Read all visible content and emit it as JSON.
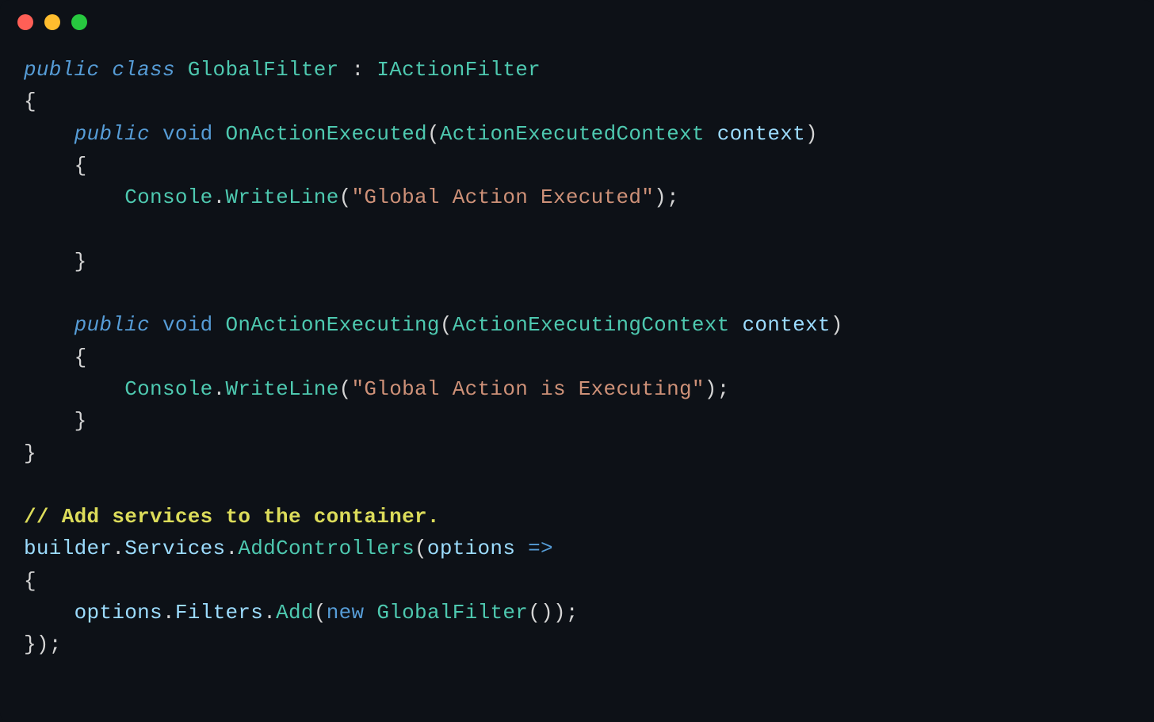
{
  "traffic_lights": {
    "red": "close",
    "yellow": "minimize",
    "green": "maximize"
  },
  "code": {
    "l1": {
      "kw_public": "public",
      "kw_class": "class",
      "name": "GlobalFilter",
      "colon": " : ",
      "iface": "IActionFilter"
    },
    "l2": {
      "brace": "{"
    },
    "l3": {
      "indent": "    ",
      "kw_public": "public",
      "kw_void": "void",
      "method": "OnActionExecuted",
      "lpar": "(",
      "ptype": "ActionExecutedContext",
      "pname": "context",
      "rpar": ")"
    },
    "l4": {
      "indent": "    ",
      "brace": "{"
    },
    "l5": {
      "indent": "        ",
      "cls": "Console",
      "dot": ".",
      "method": "WriteLine",
      "lpar": "(",
      "str": "\"Global Action Executed\"",
      "rpar": ")",
      "semi": ";"
    },
    "l6": {
      "blank": ""
    },
    "l7": {
      "indent": "    ",
      "brace": "}"
    },
    "l8": {
      "blank": ""
    },
    "l9": {
      "indent": "    ",
      "kw_public": "public",
      "kw_void": "void",
      "method": "OnActionExecuting",
      "lpar": "(",
      "ptype": "ActionExecutingContext",
      "pname": "context",
      "rpar": ")"
    },
    "l10": {
      "indent": "    ",
      "brace": "{"
    },
    "l11": {
      "indent": "        ",
      "cls": "Console",
      "dot": ".",
      "method": "WriteLine",
      "lpar": "(",
      "str": "\"Global Action is Executing\"",
      "rpar": ")",
      "semi": ";"
    },
    "l12": {
      "indent": "    ",
      "brace": "}"
    },
    "l13": {
      "brace": "}"
    },
    "l14": {
      "blank": ""
    },
    "l15": {
      "comment": "// Add services to the container."
    },
    "l16": {
      "var": "builder",
      "d1": ".",
      "p1": "Services",
      "d2": ".",
      "m1": "AddControllers",
      "lpar": "(",
      "param": "options",
      "arrow": " =>"
    },
    "l17": {
      "brace": "{"
    },
    "l18": {
      "indent": "    ",
      "var": "options",
      "d1": ".",
      "p1": "Filters",
      "d2": ".",
      "m1": "Add",
      "lpar": "(",
      "kw_new": "new",
      "sp": " ",
      "ctor": "GlobalFilter",
      "lpar2": "(",
      "rpar2": ")",
      "rpar": ")",
      "semi": ";"
    },
    "l19": {
      "brace": "}",
      "rpar": ")",
      "semi": ";"
    }
  }
}
